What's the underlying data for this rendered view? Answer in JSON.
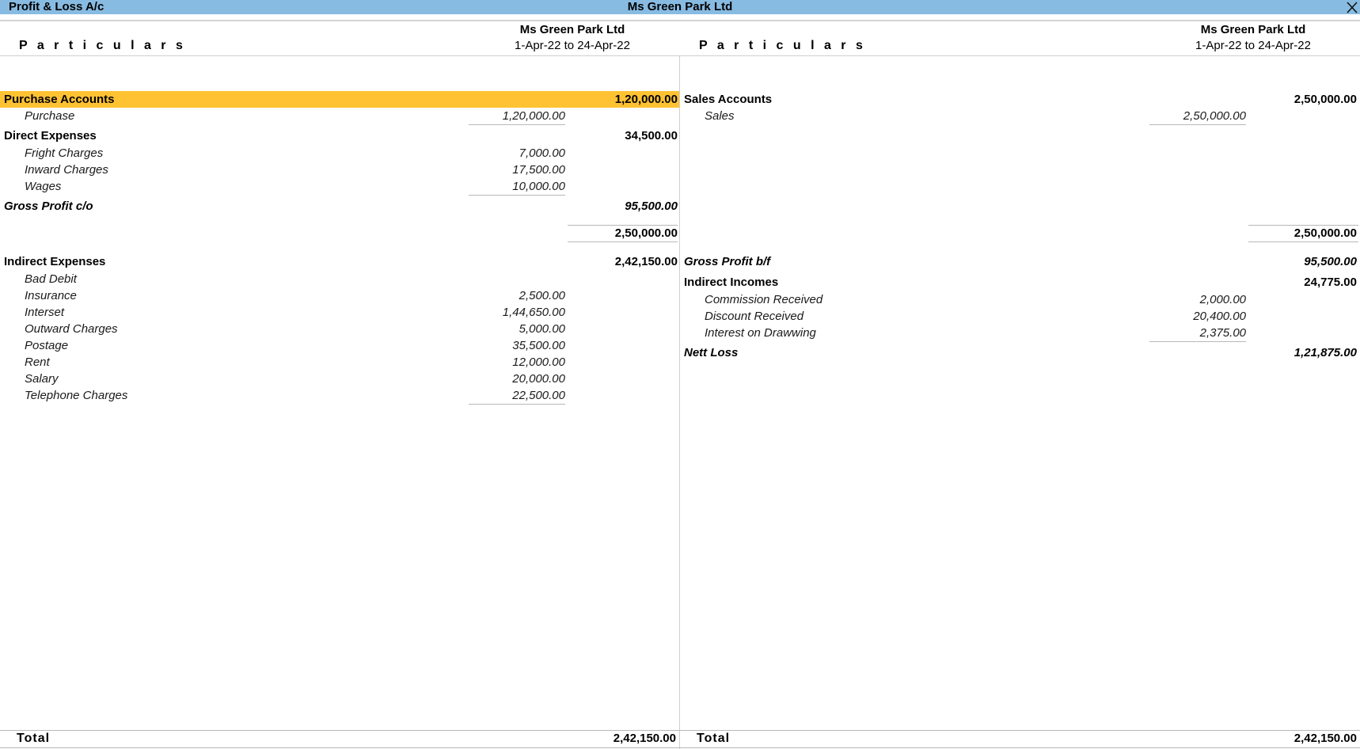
{
  "window": {
    "title": "Profit & Loss A/c",
    "company": "Ms Green Park Ltd",
    "close_icon": "close-icon"
  },
  "columns": {
    "particulars_label": "P a r t i c u l a r s",
    "company": "Ms Green Park Ltd",
    "period": "1-Apr-22 to 24-Apr-22"
  },
  "debit": {
    "purchase_accounts": {
      "label": "Purchase Accounts",
      "amount": "1,20,000.00",
      "items": [
        {
          "label": "Purchase",
          "amount": "1,20,000.00"
        }
      ]
    },
    "direct_expenses": {
      "label": "Direct Expenses",
      "amount": "34,500.00",
      "items": [
        {
          "label": "Fright Charges",
          "amount": "7,000.00"
        },
        {
          "label": "Inward Charges",
          "amount": "17,500.00"
        },
        {
          "label": "Wages",
          "amount": "10,000.00"
        }
      ]
    },
    "gross_profit_co": {
      "label": "Gross Profit c/o",
      "amount": "95,500.00"
    },
    "subtotal": "2,50,000.00",
    "indirect_expenses": {
      "label": "Indirect Expenses",
      "amount": "2,42,150.00",
      "items": [
        {
          "label": "Bad Debit",
          "amount": ""
        },
        {
          "label": "Insurance",
          "amount": "2,500.00"
        },
        {
          "label": "Interset",
          "amount": "1,44,650.00"
        },
        {
          "label": "Outward Charges",
          "amount": "5,000.00"
        },
        {
          "label": "Postage",
          "amount": "35,500.00"
        },
        {
          "label": "Rent",
          "amount": "12,000.00"
        },
        {
          "label": "Salary",
          "amount": "20,000.00"
        },
        {
          "label": "Telephone Charges",
          "amount": "22,500.00"
        }
      ]
    },
    "total_label": "Total",
    "total": "2,42,150.00"
  },
  "credit": {
    "sales_accounts": {
      "label": "Sales Accounts",
      "amount": "2,50,000.00",
      "items": [
        {
          "label": "Sales",
          "amount": "2,50,000.00"
        }
      ]
    },
    "subtotal": "2,50,000.00",
    "gross_profit_bf": {
      "label": "Gross Profit b/f",
      "amount": "95,500.00"
    },
    "indirect_incomes": {
      "label": "Indirect Incomes",
      "amount": "24,775.00",
      "items": [
        {
          "label": "Commission Received",
          "amount": "2,000.00"
        },
        {
          "label": "Discount Received",
          "amount": "20,400.00"
        },
        {
          "label": "Interest on Drawwing",
          "amount": "2,375.00"
        }
      ]
    },
    "nett_loss": {
      "label": "Nett Loss",
      "amount": "1,21,875.00"
    },
    "total_label": "Total",
    "total": "2,42,150.00"
  },
  "colors": {
    "titlebar": "#88bbe2",
    "highlight": "#ffc233"
  }
}
